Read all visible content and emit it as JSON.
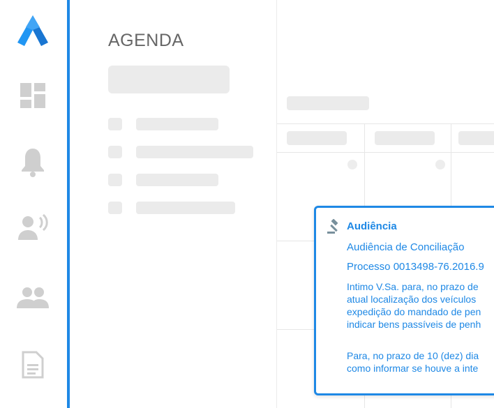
{
  "brand": {
    "logo": "a-logo-icon",
    "accent": "#1e88e5"
  },
  "sidebar": {
    "items": [
      {
        "icon": "dashboard-icon"
      },
      {
        "icon": "bell-icon"
      },
      {
        "icon": "speaker-icon"
      },
      {
        "icon": "people-icon"
      },
      {
        "icon": "document-icon"
      }
    ]
  },
  "agenda": {
    "title": "AGENDA"
  },
  "event": {
    "icon": "gavel-icon",
    "type": "Audiência",
    "subtitle": "Audiência de Conciliação",
    "process": "Processo 0013498-76.2016.9",
    "paragraph1": "Intimo V.Sa. para, no prazo de\natual localização dos veículos\nexpedição do mandado de pen\nindicar bens passíveis de penh",
    "paragraph2": "Para, no prazo de 10 (dez) dia\ncomo informar se houve a inte"
  }
}
